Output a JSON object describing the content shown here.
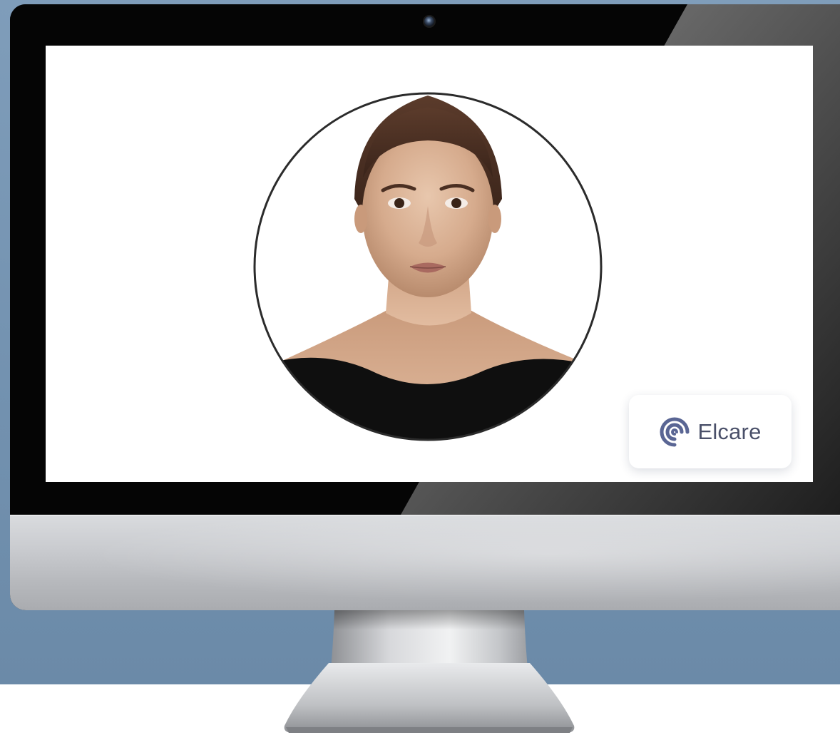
{
  "brand": {
    "name": "Elcare",
    "logo_icon": "spiral-logo-icon",
    "logo_color": "#5a6694"
  },
  "colors": {
    "backdrop": "#7392b0",
    "bezel": "#050505",
    "chin": "#c9cbcf",
    "screen": "#ffffff",
    "avatar_ring": "#2b2b2b"
  },
  "screen": {
    "portrait_icon": "woman-portrait-icon"
  }
}
